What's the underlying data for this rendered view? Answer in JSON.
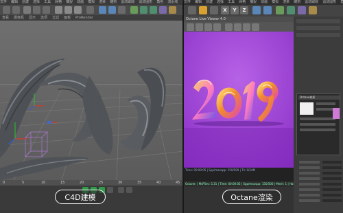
{
  "left_app": {
    "menu": [
      "文件",
      "编辑",
      "创建",
      "选择",
      "工具",
      "网格",
      "捕捉",
      "动画",
      "模拟",
      "渲染",
      "雕刻",
      "运动跟踪",
      "运动图形",
      "角色",
      "流水线",
      "插件",
      "X-Particles",
      "RealFlow",
      "Octane",
      "脚本"
    ],
    "view_menu": [
      "查看",
      "摄像机",
      "显示",
      "选项",
      "过滤",
      "面板",
      "ProRender"
    ],
    "timeline_ticks": [
      "0",
      "5",
      "10",
      "15",
      "20",
      "25",
      "30",
      "35",
      "40",
      "45"
    ]
  },
  "right_app": {
    "menu": [
      "文件",
      "编辑",
      "创建",
      "选择",
      "工具",
      "网格",
      "捕捉",
      "动画",
      "模拟",
      "渲染",
      "雕刻",
      "运动跟踪",
      "运动图形",
      "角色",
      "流水线",
      "插件",
      "X-Particles",
      "RealFlow",
      "Octane"
    ],
    "toolbar_xyz": [
      "X",
      "Y",
      "Z"
    ],
    "live_viewer_title": "Octane Live Viewer 4.0",
    "render_artwork": "2019",
    "render_status": "Time: 00:00:05 | Spp/maxspp: 150/500 | Tri: 0/24M",
    "render_footer": "Octane: | MsPSec: 5.31 | Time: 00:00:05 | Spp/maxspp: 150/500 | Mesh: 1 | Hair: 0",
    "panel_title": "Octane材质"
  },
  "labels": {
    "left": "C4D建模",
    "right": "Octane渲染"
  },
  "colors": {
    "render_bg": "#9b3fd4",
    "accent_orange": "#e8a23a"
  }
}
